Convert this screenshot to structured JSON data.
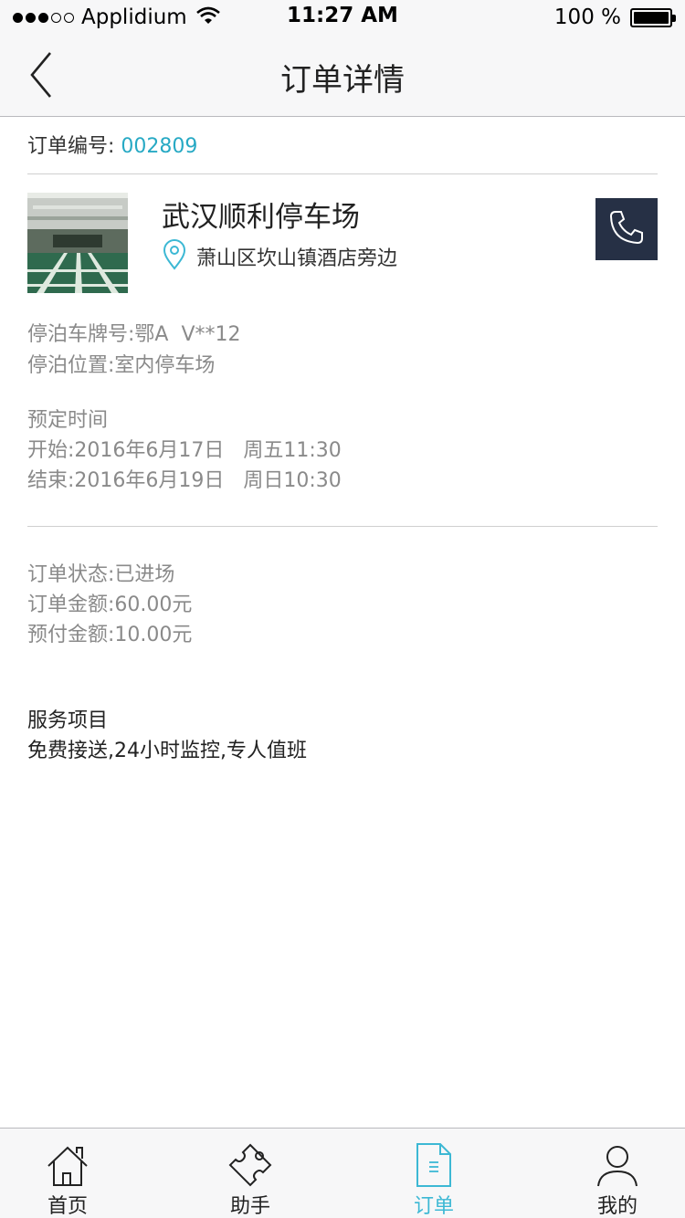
{
  "status_bar": {
    "carrier": "Applidium",
    "time": "11:27 AM",
    "battery": "100 %"
  },
  "nav": {
    "title": "订单详情",
    "back_icon": "chevron-left-icon"
  },
  "order": {
    "number_label": "订单编号:",
    "number_value": "002809"
  },
  "lot": {
    "name": "武汉顺利停车场",
    "address": "萧山区坎山镇酒店旁边",
    "location_icon": "map-pin-icon",
    "call_icon": "phone-icon"
  },
  "parking": {
    "plate": "停泊车牌号:鄂A  V**12",
    "position": "停泊位置:室内停车场"
  },
  "schedule": {
    "heading": "预定时间",
    "start": "开始:2016年6月17日   周五11:30",
    "end": "结束:2016年6月19日   周日10:30"
  },
  "status": {
    "state": "订单状态:已进场",
    "amount": "订单金额:60.00元",
    "prepaid": "预付金额:10.00元"
  },
  "services": {
    "heading": "服务项目",
    "items": "免费接送,24小时监控,专人值班"
  },
  "tabs": [
    {
      "label": "首页",
      "icon": "home-icon",
      "active": false
    },
    {
      "label": "助手",
      "icon": "puzzle-icon",
      "active": false
    },
    {
      "label": "订单",
      "icon": "document-icon",
      "active": true
    },
    {
      "label": "我的",
      "icon": "user-icon",
      "active": false
    }
  ],
  "colors": {
    "accent": "#3cb8d4",
    "order_number": "#27a9c4",
    "call_button_bg": "#263045",
    "muted_text": "#8a8a8a"
  }
}
